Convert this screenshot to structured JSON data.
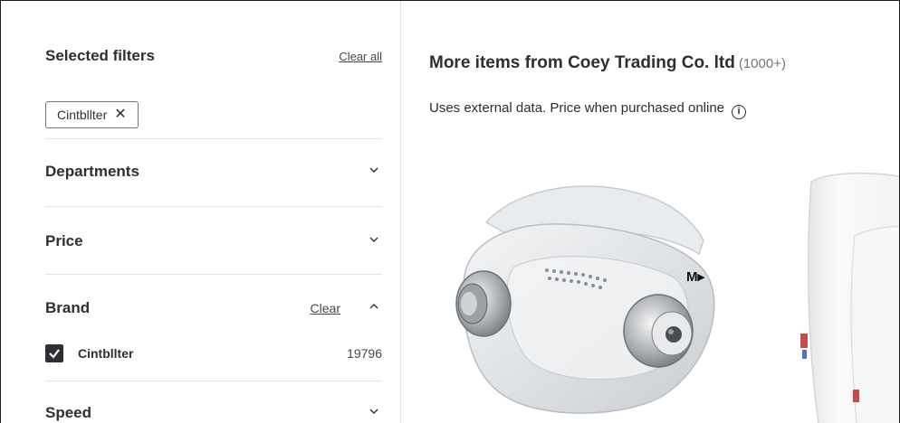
{
  "filters": {
    "title": "Selected filters",
    "clear_all_label": "Clear all",
    "chips": [
      {
        "label": "Cintbllter",
        "remove_glyph": "✕"
      }
    ]
  },
  "facets": {
    "departments": {
      "label": "Departments",
      "state": "collapsed"
    },
    "price": {
      "label": "Price",
      "state": "collapsed"
    },
    "brand": {
      "label": "Brand",
      "state": "expanded",
      "clear_label": "Clear",
      "options": [
        {
          "name": "Cintbllter",
          "count": "19796",
          "checked": true
        }
      ]
    },
    "speed": {
      "label": "Speed",
      "state": "collapsed"
    }
  },
  "main": {
    "title": "More items from Coey Trading Co. ltd",
    "count": "(1000+)",
    "subtitle": "Uses external data. Price when purchased online",
    "info_glyph": "i"
  },
  "products": [
    {
      "image": "cpap-mask",
      "badge": "M▸"
    },
    {
      "image": "pillows"
    }
  ],
  "colors": {
    "text": "#2e2f32",
    "muted": "#74767c",
    "divider": "#e3e4e5"
  }
}
